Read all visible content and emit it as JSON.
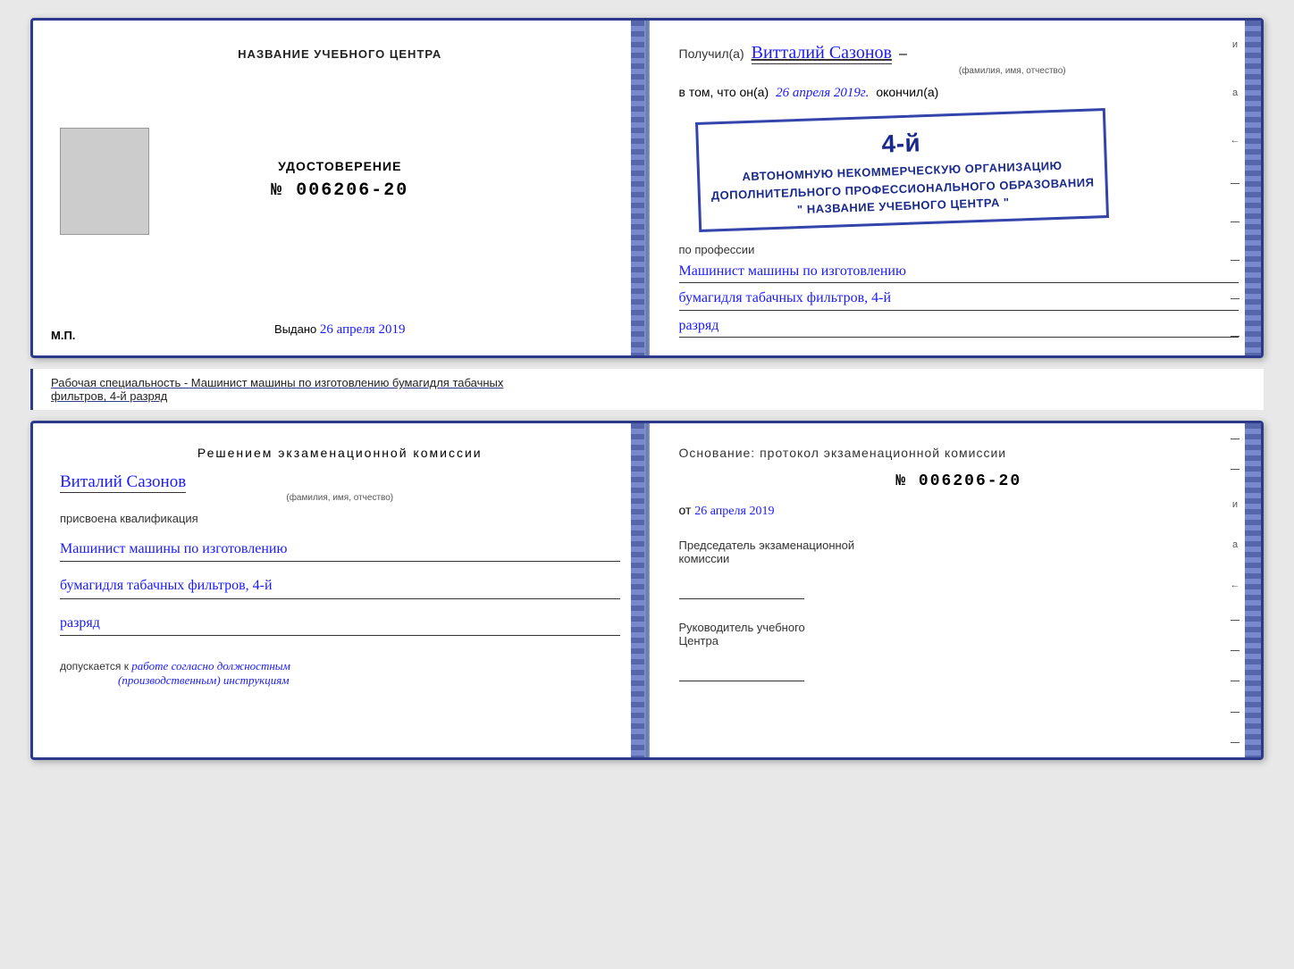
{
  "topCert": {
    "leftPage": {
      "title": "НАЗВАНИЕ УЧЕБНОГО ЦЕНТРА",
      "photoAlt": "фото",
      "certLabel": "УДОСТОВЕРЕНИЕ",
      "certNumber": "№ 006206-20",
      "issuedLabel": "Выдано",
      "issuedDate": "26 апреля 2019",
      "mpLabel": "М.П."
    },
    "rightPage": {
      "recipientLabel": "Получил(а)",
      "recipientName": "Витталий  Сазонов",
      "recipientSubLabel": "(фамилия, имя, отчество)",
      "dashSymbol": "–",
      "vtomLabel": "в том, что он(а)",
      "completedDate": "26 апреля 2019г.",
      "completedLabel": "окончил(а)",
      "stampLine1": "4-й",
      "stampLine2": "АВТОНОМНУЮ НЕКОММЕРЧЕСКУЮ ОРГАНИЗАЦИЮ",
      "stampLine3": "ДОПОЛНИТЕЛЬНОГО ПРОФЕССИОНАЛЬНОГО ОБРАЗОВАНИЯ",
      "stampLine4": "\" НАЗВАНИЕ УЧЕБНОГО ЦЕНТРА \"",
      "iLabel": "и",
      "aLabel": "а",
      "arrowLabel": "←",
      "professionLabel": "по профессии",
      "professionLine1": "Машинист машины по изготовлению",
      "professionLine2": "бумагидля табачных фильтров, 4-й",
      "professionLine3": "разряд"
    }
  },
  "infoBar": {
    "label": "Рабочая специальность - Машинист машины по изготовлению бумагидля табачных",
    "label2": "фильтров, 4-й разряд"
  },
  "bottomCert": {
    "leftPage": {
      "decisionTitle": "Решением  экзаменационной  комиссии",
      "recipientName": "Виталий  Сазонов",
      "recipientSubLabel": "(фамилия, имя, отчество)",
      "assignedLabel": "присвоена квалификация",
      "qualificationLine1": "Машинист  машины  по  изготовлению",
      "qualificationLine2": "бумагидля  табачных  фильтров, 4-й",
      "qualificationLine3": "разряд",
      "allowedLabel": "допускается к",
      "allowedText": "работе согласно должностным",
      "allowedText2": "(производственным) инструкциям"
    },
    "rightPage": {
      "basisLabel": "Основание: протокол экзаменационной  комиссии",
      "protocolNumber": "№  006206-20",
      "datePrefix": "от",
      "protocolDate": "26 апреля 2019",
      "chairmanLabel": "Председатель экзаменационной",
      "chairmanLabel2": "комиссии",
      "headLabel": "Руководитель учебного",
      "headLabel2": "Центра",
      "iLabel": "и",
      "aLabel": "а",
      "arrowLabel": "←"
    }
  }
}
